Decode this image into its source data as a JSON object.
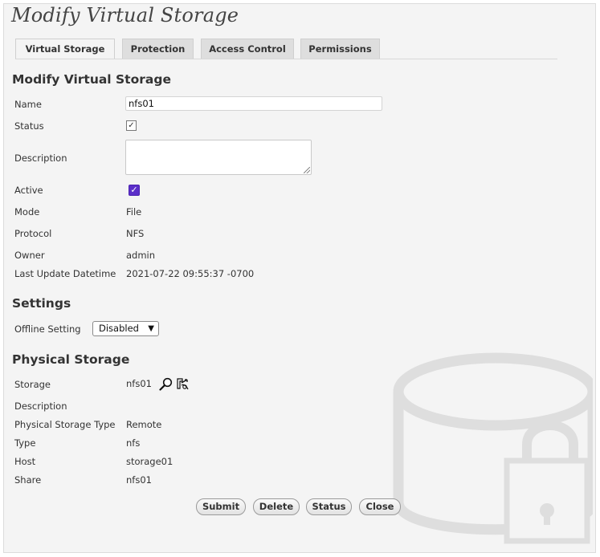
{
  "page_title": "Modify Virtual Storage",
  "tabs": [
    {
      "label": "Virtual Storage",
      "active": true
    },
    {
      "label": "Protection",
      "active": false
    },
    {
      "label": "Access Control",
      "active": false
    },
    {
      "label": "Permissions",
      "active": false
    }
  ],
  "section_modify": {
    "title": "Modify Virtual Storage",
    "name_label": "Name",
    "name_value": "nfs01",
    "status_label": "Status",
    "status_checked": true,
    "description_label": "Description",
    "description_value": "",
    "active_label": "Active",
    "active_checked": true,
    "mode_label": "Mode",
    "mode_value": "File",
    "protocol_label": "Protocol",
    "protocol_value": "NFS",
    "owner_label": "Owner",
    "owner_value": "admin",
    "last_update_label": "Last Update Datetime",
    "last_update_value": "2021-07-22 09:55:37 -0700"
  },
  "section_settings": {
    "title": "Settings",
    "offline_label": "Offline Setting",
    "offline_value": "Disabled"
  },
  "section_physical": {
    "title": "Physical Storage",
    "storage_label": "Storage",
    "storage_value": "nfs01",
    "description_label": "Description",
    "description_value": "",
    "type_full_label": "Physical Storage Type",
    "type_full_value": "Remote",
    "type_label": "Type",
    "type_value": "nfs",
    "host_label": "Host",
    "host_value": "storage01",
    "share_label": "Share",
    "share_value": "nfs01"
  },
  "buttons": {
    "submit": "Submit",
    "delete": "Delete",
    "status": "Status",
    "close": "Close"
  },
  "icons": {
    "search": "magnifier-icon",
    "storage_edit": "storage-link-icon",
    "watermark": "locked-database-icon"
  },
  "colors": {
    "checkbox_accent": "#5b2fc9",
    "panel_bg": "#f4f4f4",
    "watermark": "#e2e2e2"
  }
}
